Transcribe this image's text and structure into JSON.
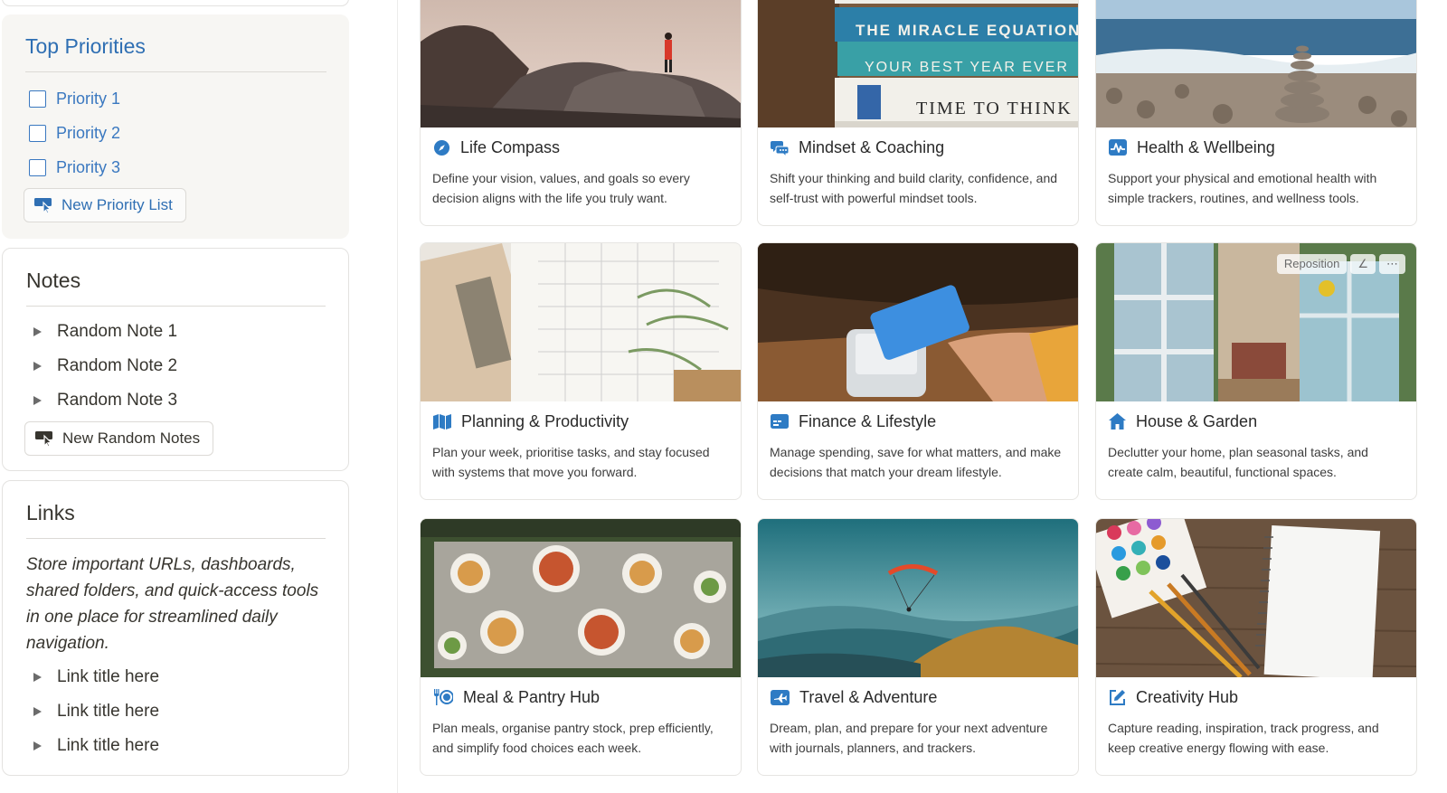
{
  "priorities": {
    "title": "Top Priorities",
    "items": [
      {
        "label": "Priority 1"
      },
      {
        "label": "Priority 2"
      },
      {
        "label": "Priority 3"
      }
    ],
    "button": "New Priority List"
  },
  "notes": {
    "title": "Notes",
    "items": [
      {
        "label": "Random Note 1"
      },
      {
        "label": "Random Note 2"
      },
      {
        "label": "Random Note 3"
      }
    ],
    "button": "New Random Notes"
  },
  "links": {
    "title": "Links",
    "description": "Store important URLs, dashboards, shared folders, and quick-access tools in one place for streamlined daily navigation.",
    "items": [
      {
        "label": "Link title here"
      },
      {
        "label": "Link title here"
      },
      {
        "label": "Link title here"
      }
    ]
  },
  "hubs": [
    {
      "title": "Life Compass",
      "icon": "compass-icon",
      "description": "Define your vision, values, and goals so every decision aligns with the life you truly want."
    },
    {
      "title": "Mindset & Coaching",
      "icon": "chat-bubbles-icon",
      "description": "Shift your thinking and build clarity, confidence, and self-trust with powerful mindset tools."
    },
    {
      "title": "Health & Wellbeing",
      "icon": "heart-pulse-icon",
      "description": "Support your physical and emotional health with simple trackers, routines, and wellness tools."
    },
    {
      "title": "Planning & Productivity",
      "icon": "map-icon",
      "description": "Plan your week, prioritise tasks, and stay focused with systems that move you forward."
    },
    {
      "title": "Finance & Lifestyle",
      "icon": "credit-card-icon",
      "description": "Manage spending, save for what matters, and make decisions that match your dream lifestyle."
    },
    {
      "title": "House & Garden",
      "icon": "house-icon",
      "description": "Declutter your home, plan seasonal tasks, and create calm, beautiful, functional spaces."
    },
    {
      "title": "Meal & Pantry Hub",
      "icon": "utensils-icon",
      "description": "Plan meals, organise pantry stock, prep efficiently, and simplify food choices each week."
    },
    {
      "title": "Travel & Adventure",
      "icon": "airplane-ticket-icon",
      "description": "Dream, plan, and prepare for your next adventure with journals, planners, and trackers."
    },
    {
      "title": "Creativity Hub",
      "icon": "pencil-square-icon",
      "description": "Capture reading, inspiration, track progress, and keep creative energy flowing with ease."
    }
  ],
  "covers": {
    "mindset_books": [
      "THE MIRACLE EQUATION",
      "YOUR BEST YEAR EVER",
      "TIME TO THINK"
    ],
    "reposition_label": "Reposition"
  },
  "colors": {
    "accent_blue": "#2f6fb3",
    "icon_blue": "#2e7bc4",
    "sidebar_bg": "#f7f6f3"
  }
}
